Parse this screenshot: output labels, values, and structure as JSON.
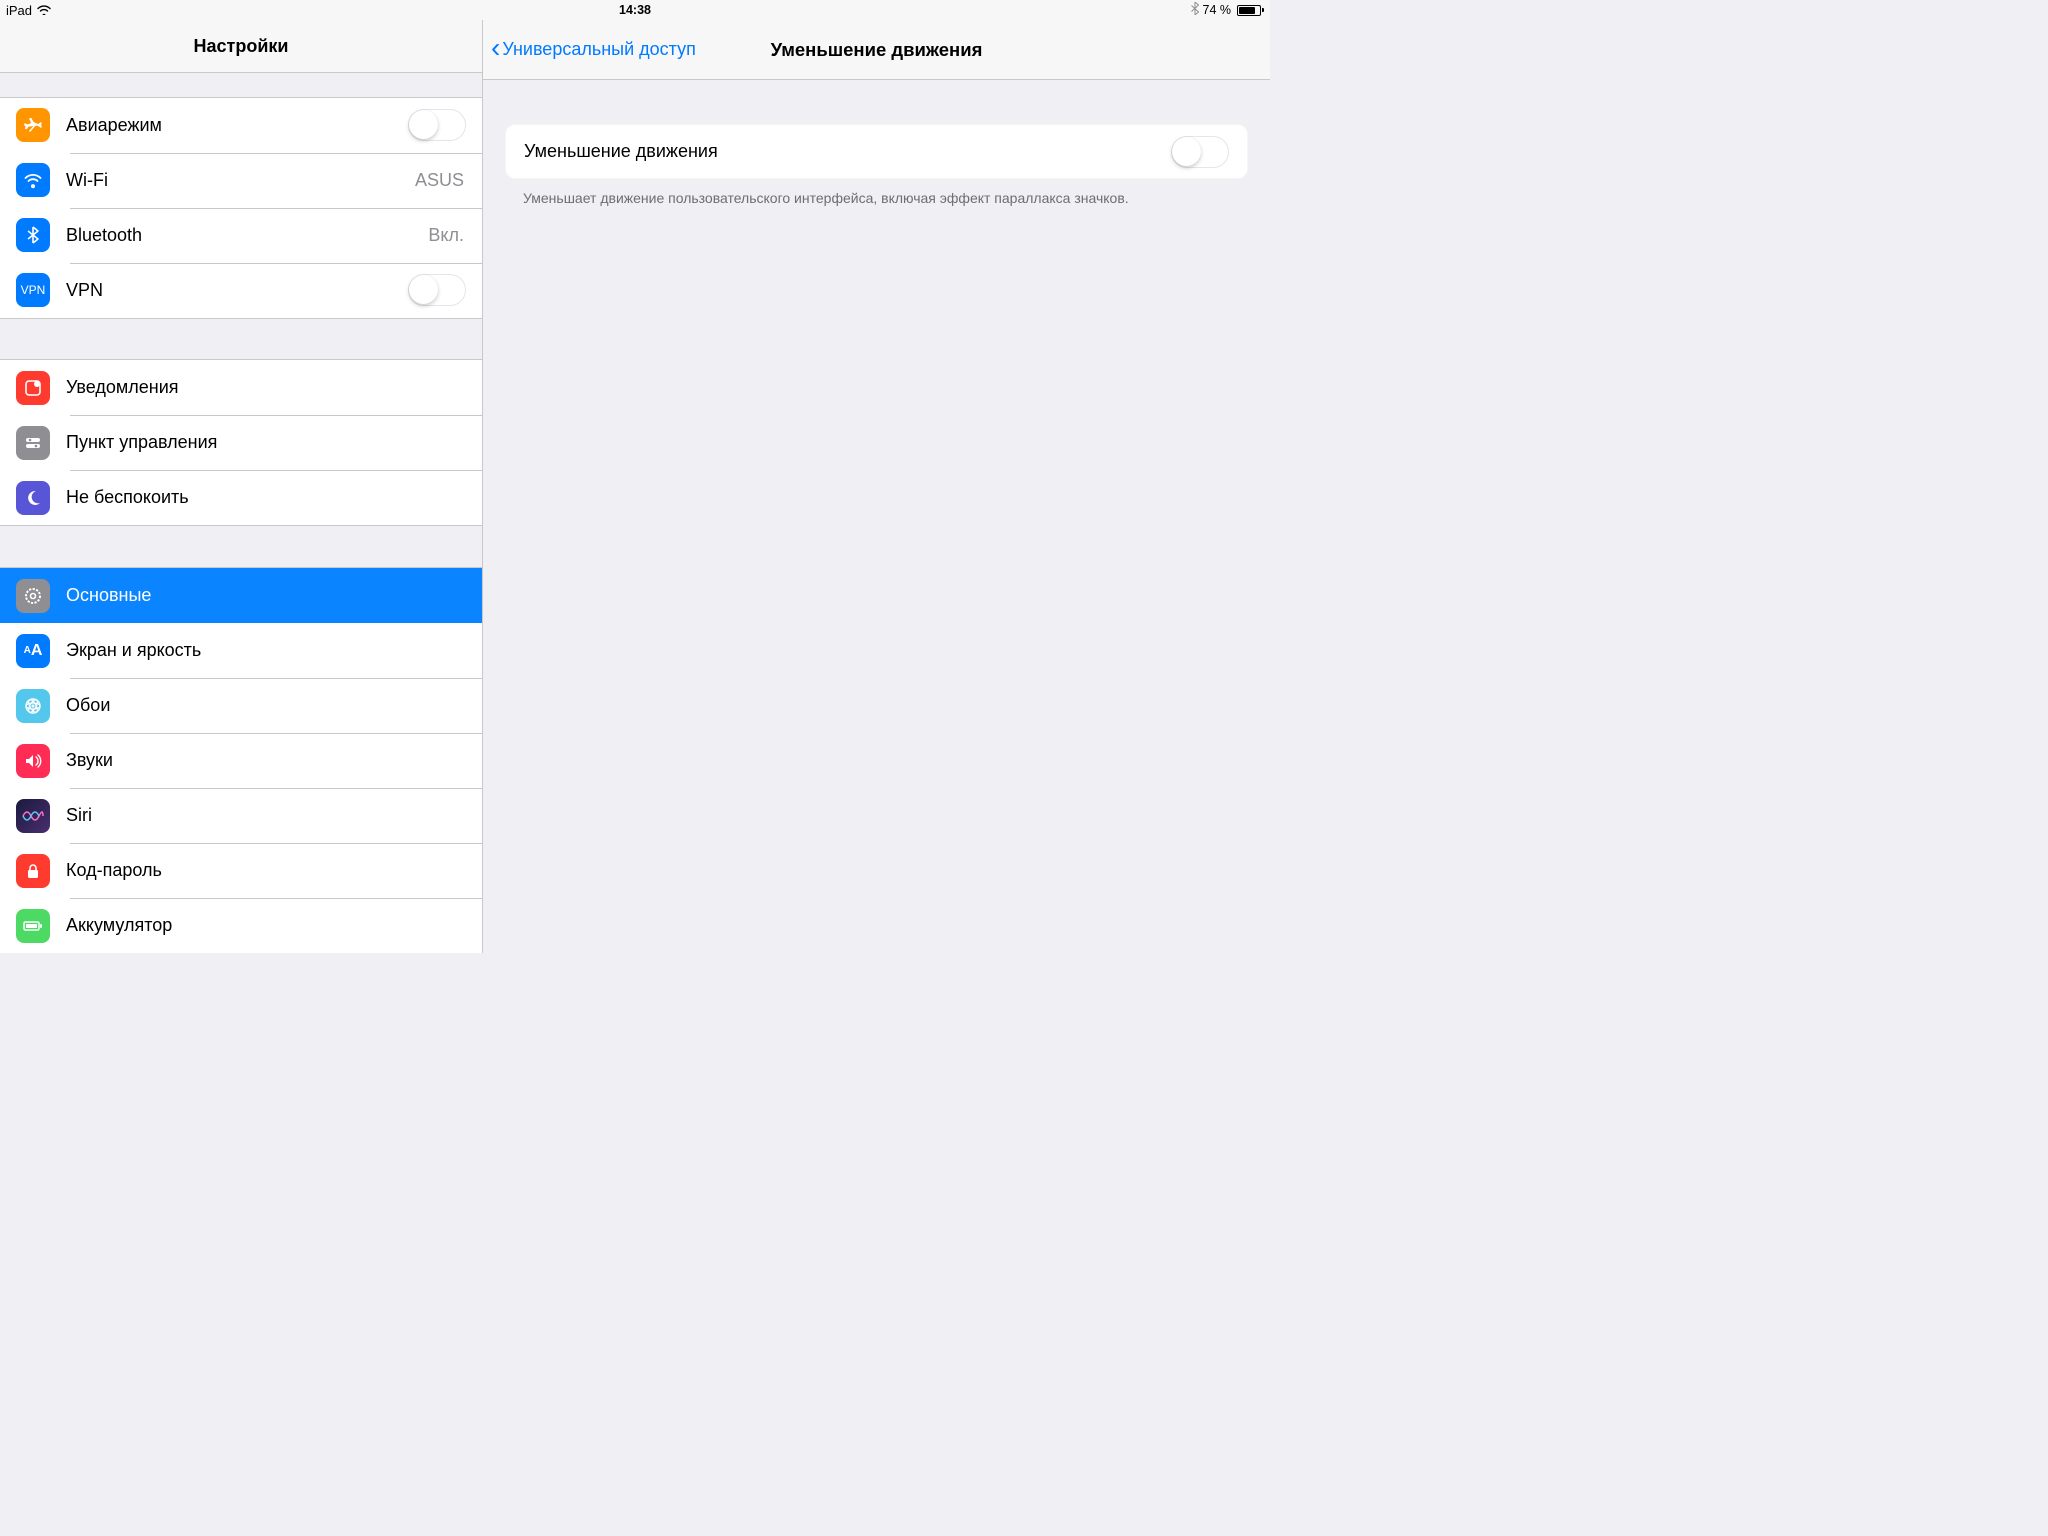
{
  "status": {
    "device": "iPad",
    "time": "14:38",
    "battery_pct": "74 %"
  },
  "sidebar": {
    "title": "Настройки",
    "g1": {
      "airplane": "Авиарежим",
      "wifi": "Wi-Fi",
      "wifi_val": "ASUS",
      "bt": "Bluetooth",
      "bt_val": "Вкл.",
      "vpn": "VPN"
    },
    "g2": {
      "notif": "Уведомления",
      "control": "Пункт управления",
      "dnd": "Не беспокоить"
    },
    "g3": {
      "general": "Основные",
      "display": "Экран и яркость",
      "wallpaper": "Обои",
      "sounds": "Звуки",
      "siri": "Siri",
      "passcode": "Код-пароль",
      "battery": "Аккумулятор"
    }
  },
  "detail": {
    "back": "Универсальный доступ",
    "title": "Уменьшение движения",
    "row": "Уменьшение движения",
    "footer": "Уменьшает движение пользовательского интерфейса, включая эффект параллакса значков."
  }
}
